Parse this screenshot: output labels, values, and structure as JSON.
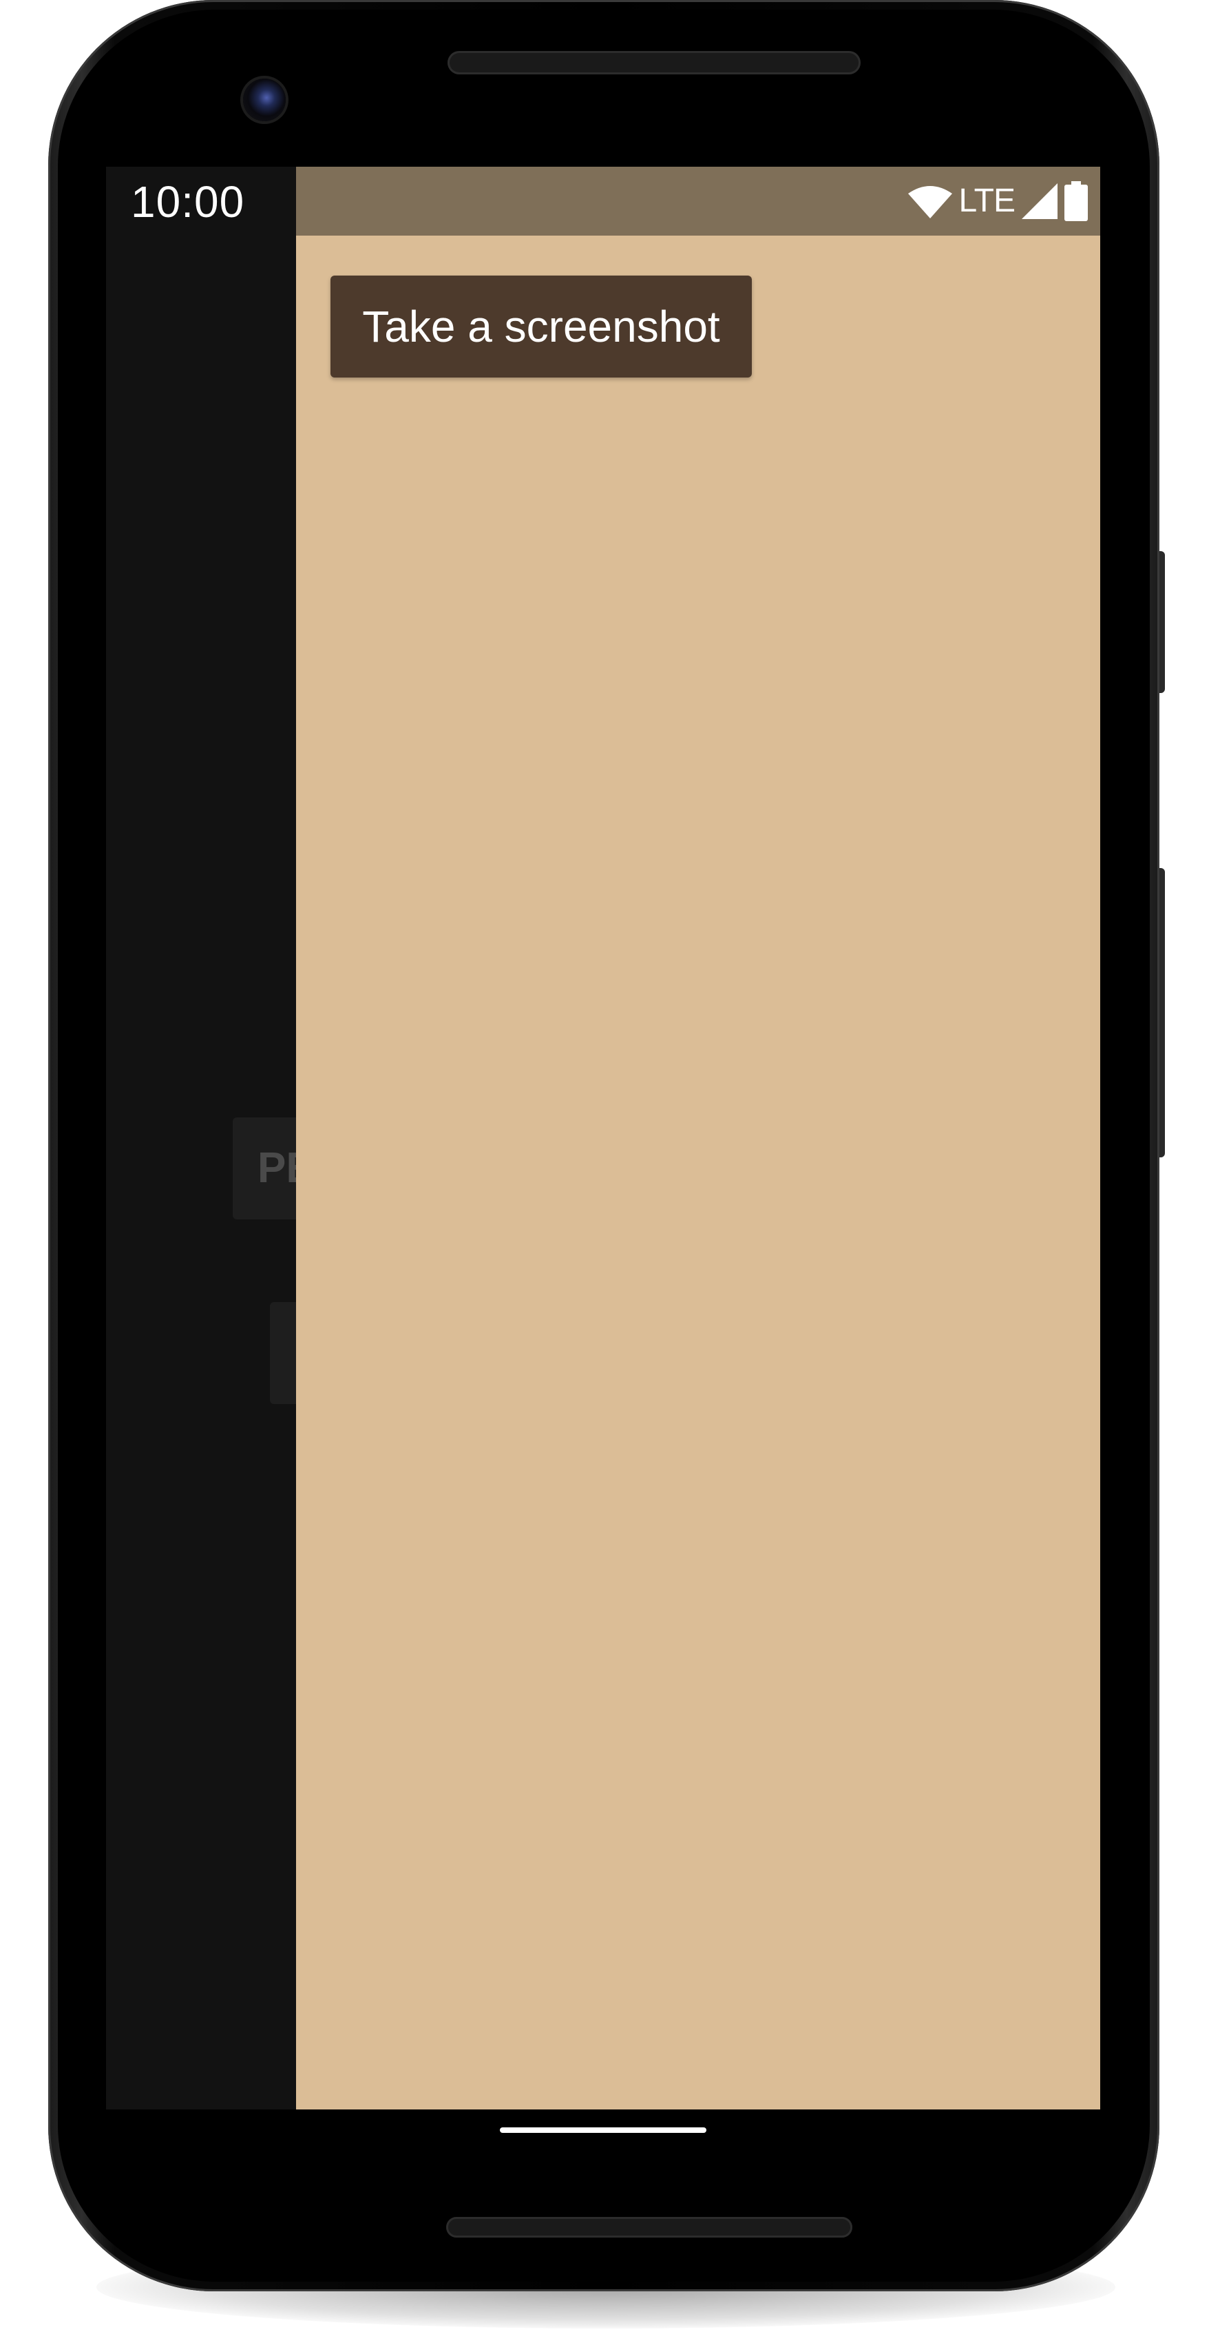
{
  "status_bar": {
    "time": "10:00",
    "network_label": "LTE",
    "icons": [
      "wifi-icon",
      "signal-icon",
      "battery-icon"
    ]
  },
  "overlay": {
    "screenshot_button_label": "Take a screenshot"
  },
  "background_app": {
    "button_1_label": "PE",
    "button_2_label": ""
  },
  "colors": {
    "overlay_background": "#dbbd96",
    "overlay_status_bar": "#7f6f58",
    "button_background": "#4d3a2c",
    "app_background": "#121212"
  }
}
